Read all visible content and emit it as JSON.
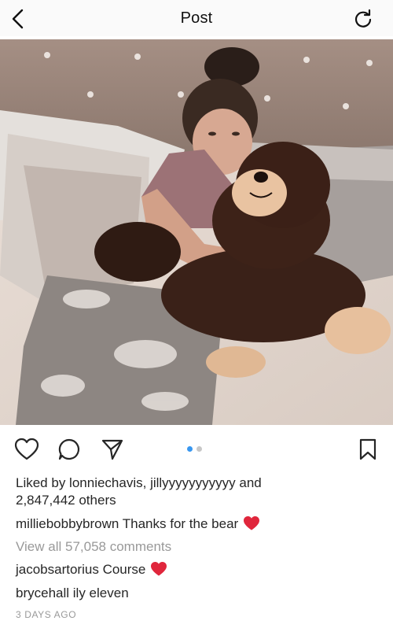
{
  "header": {
    "title": "Post"
  },
  "post": {
    "liked_by_prefix": "Liked by ",
    "liked_user_1": "lonniechavis",
    "liked_sep": ", ",
    "liked_user_2": "jillyyyyyyyyyyy",
    "liked_and": " and",
    "liked_others": "2,847,442 others",
    "caption_user": "milliebobbybrown",
    "caption_text": "Thanks for the bear",
    "view_all": "View all 57,058 comments",
    "comments": [
      {
        "user": "jacobsartorius",
        "text": "Course",
        "emoji": "heart"
      },
      {
        "user": "brycehall",
        "text": "ily eleven"
      }
    ],
    "time": "3 DAYS AGO",
    "carousel": {
      "count": 2,
      "active": 1
    }
  },
  "colors": {
    "accent": "#3897f0",
    "heart": "#e0263c",
    "muted": "#999999"
  },
  "icons": [
    "back-icon",
    "refresh-icon",
    "heart-icon",
    "comment-icon",
    "share-icon",
    "bookmark-icon"
  ]
}
